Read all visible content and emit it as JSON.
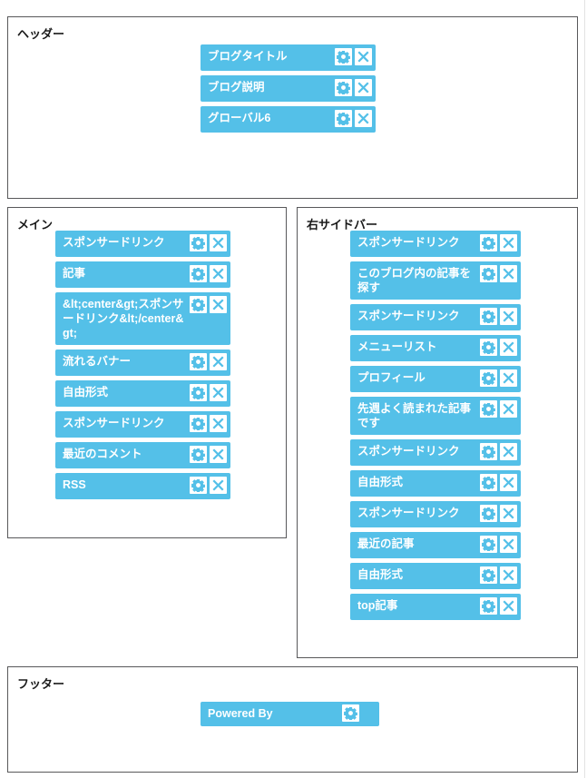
{
  "page": {
    "accent_color": "#54c0e8",
    "panel_border_color": "#58585a",
    "widget_text_color": "#ffffff"
  },
  "icons": {
    "settings": "gear-icon",
    "remove": "close-icon"
  },
  "sections": {
    "header": {
      "label": "ヘッダー",
      "widgets": [
        {
          "title": "ブログタイトル",
          "has_settings": true,
          "has_remove": true
        },
        {
          "title": "ブログ説明",
          "has_settings": true,
          "has_remove": true
        },
        {
          "title": "グローバル6",
          "has_settings": true,
          "has_remove": true
        }
      ]
    },
    "main": {
      "label": "メイン",
      "widgets": [
        {
          "title": "スポンサードリンク",
          "has_settings": true,
          "has_remove": true
        },
        {
          "title": "記事",
          "has_settings": true,
          "has_remove": true
        },
        {
          "title": "&lt;center&gt;スポンサードリンク&lt;/center&gt;",
          "has_settings": true,
          "has_remove": true
        },
        {
          "title": "流れるバナー",
          "has_settings": true,
          "has_remove": true
        },
        {
          "title": "自由形式",
          "has_settings": true,
          "has_remove": true
        },
        {
          "title": "スポンサードリンク",
          "has_settings": true,
          "has_remove": true
        },
        {
          "title": "最近のコメント",
          "has_settings": true,
          "has_remove": true
        },
        {
          "title": "RSS",
          "has_settings": true,
          "has_remove": true
        }
      ]
    },
    "sidebar": {
      "label": "右サイドバー",
      "widgets": [
        {
          "title": "スポンサードリンク",
          "has_settings": true,
          "has_remove": true
        },
        {
          "title": "このブログ内の記事を探す",
          "has_settings": true,
          "has_remove": true
        },
        {
          "title": "スポンサードリンク",
          "has_settings": true,
          "has_remove": true
        },
        {
          "title": "メニューリスト",
          "has_settings": true,
          "has_remove": true
        },
        {
          "title": "プロフィール",
          "has_settings": true,
          "has_remove": true
        },
        {
          "title": "先週よく読まれた記事です",
          "has_settings": true,
          "has_remove": true
        },
        {
          "title": "スポンサードリンク",
          "has_settings": true,
          "has_remove": true
        },
        {
          "title": "自由形式",
          "has_settings": true,
          "has_remove": true
        },
        {
          "title": "スポンサードリンク",
          "has_settings": true,
          "has_remove": true
        },
        {
          "title": "最近の記事",
          "has_settings": true,
          "has_remove": true
        },
        {
          "title": "自由形式",
          "has_settings": true,
          "has_remove": true
        },
        {
          "title": "top記事",
          "has_settings": true,
          "has_remove": true
        }
      ]
    },
    "footer": {
      "label": "フッター",
      "widgets": [
        {
          "title": "Powered By",
          "has_settings": true,
          "has_remove": false
        }
      ]
    }
  }
}
